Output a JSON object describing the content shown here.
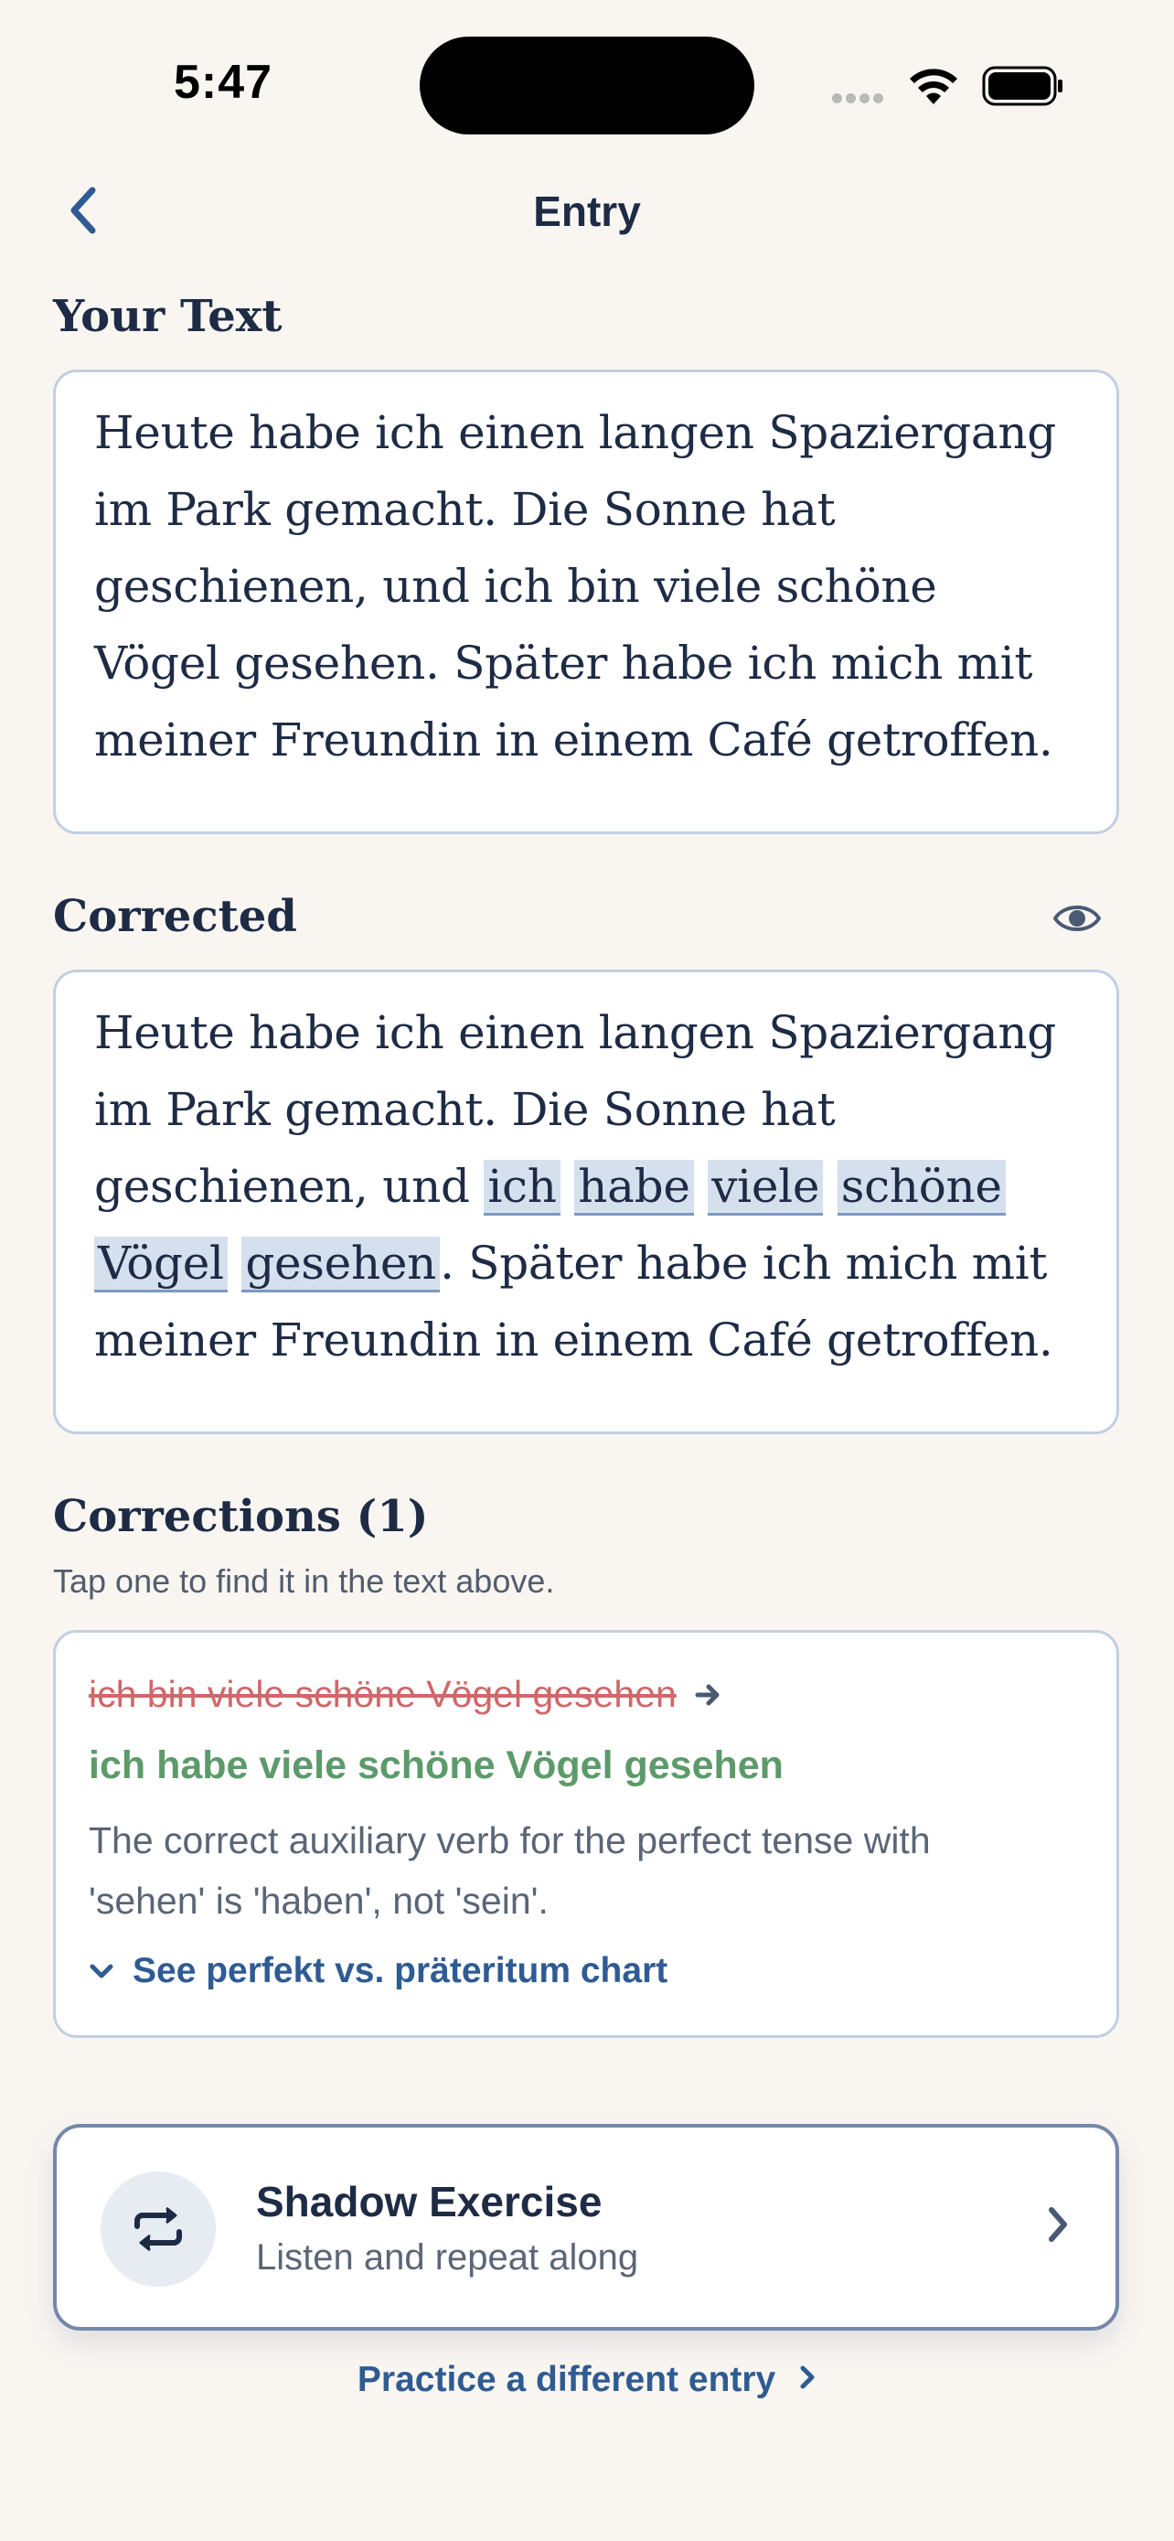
{
  "status_bar": {
    "time": "5:47"
  },
  "nav": {
    "title": "Entry"
  },
  "your_text": {
    "title": "Your Text",
    "lines": [
      "Heute habe ich einen langen Spaziergang",
      "im Park gemacht. Die Sonne hat",
      "geschienen, und ich bin viele schöne",
      "Vögel gesehen. Später habe ich mich mit",
      "meiner Freundin in einem Café getroffen."
    ]
  },
  "corrected": {
    "title": "Corrected",
    "line1": "Heute habe ich einen langen Spaziergang",
    "line2": "im Park gemacht. Die Sonne hat",
    "line3_prefix": "geschienen, und ",
    "highlight_words_line3": [
      "ich",
      "habe",
      "viele",
      "schöne"
    ],
    "highlight_words_line4": [
      "Vögel",
      "gesehen"
    ],
    "line4_suffix": ". Später habe ich mich mit",
    "line5": "meiner Freundin in einem Café getroffen."
  },
  "corrections": {
    "title": "Corrections (1)",
    "subtitle": "Tap one to find it in the text above.",
    "items": [
      {
        "original": "ich bin viele schöne Vögel gesehen",
        "corrected": "ich habe viele schöne Vögel gesehen",
        "explanation_line1": "The correct auxiliary verb for the perfect tense with",
        "explanation_line2": "'sehen' is 'haben', not 'sein'.",
        "chart_link": "See perfekt vs. präteritum chart"
      }
    ]
  },
  "shadow_exercise": {
    "title": "Shadow Exercise",
    "subtitle": "Listen and repeat along"
  },
  "practice_link": "Practice a different entry",
  "colors": {
    "background": "#f9f6f2",
    "primary_text": "#1e2b45",
    "accent_blue": "#2f5b93",
    "highlight": "#d4e0ee",
    "error_red": "#d0676a",
    "success_green": "#5c9a6a"
  },
  "icons": [
    "back-chevron-icon",
    "eye-icon",
    "arrow-right-icon",
    "chevron-down-icon",
    "repeat-icon",
    "chevron-right-icon",
    "wifi-icon",
    "battery-icon"
  ]
}
